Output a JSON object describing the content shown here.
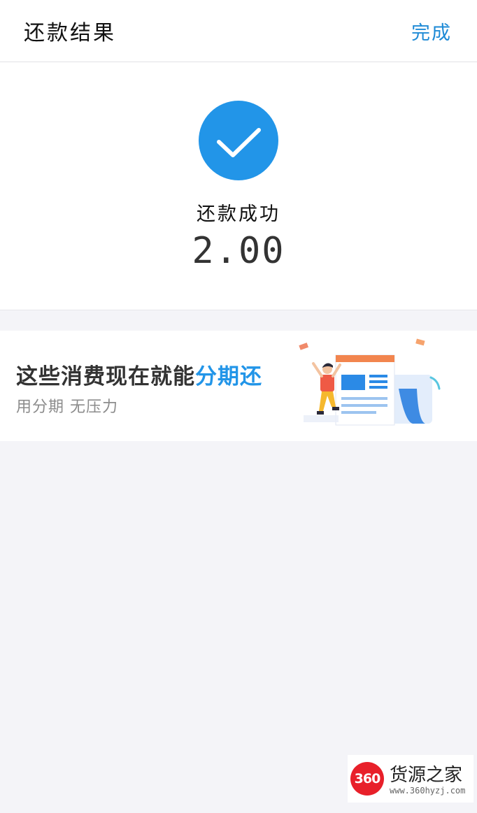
{
  "header": {
    "title": "还款结果",
    "done_label": "完成"
  },
  "result": {
    "status_text": "还款成功",
    "amount": "2.00",
    "icon": "checkmark-circle-icon"
  },
  "banner": {
    "title_prefix": "这些消费现在就能",
    "title_highlight": "分期还",
    "subtitle": "用分期 无压力"
  },
  "watermark": {
    "logo_text": "360",
    "name": "货源之家",
    "url": "www.360hyzj.com"
  },
  "colors": {
    "accent": "#2295e8",
    "link": "#1e8ad6",
    "background": "#f4f4f8",
    "watermark_red": "#e8202a"
  }
}
